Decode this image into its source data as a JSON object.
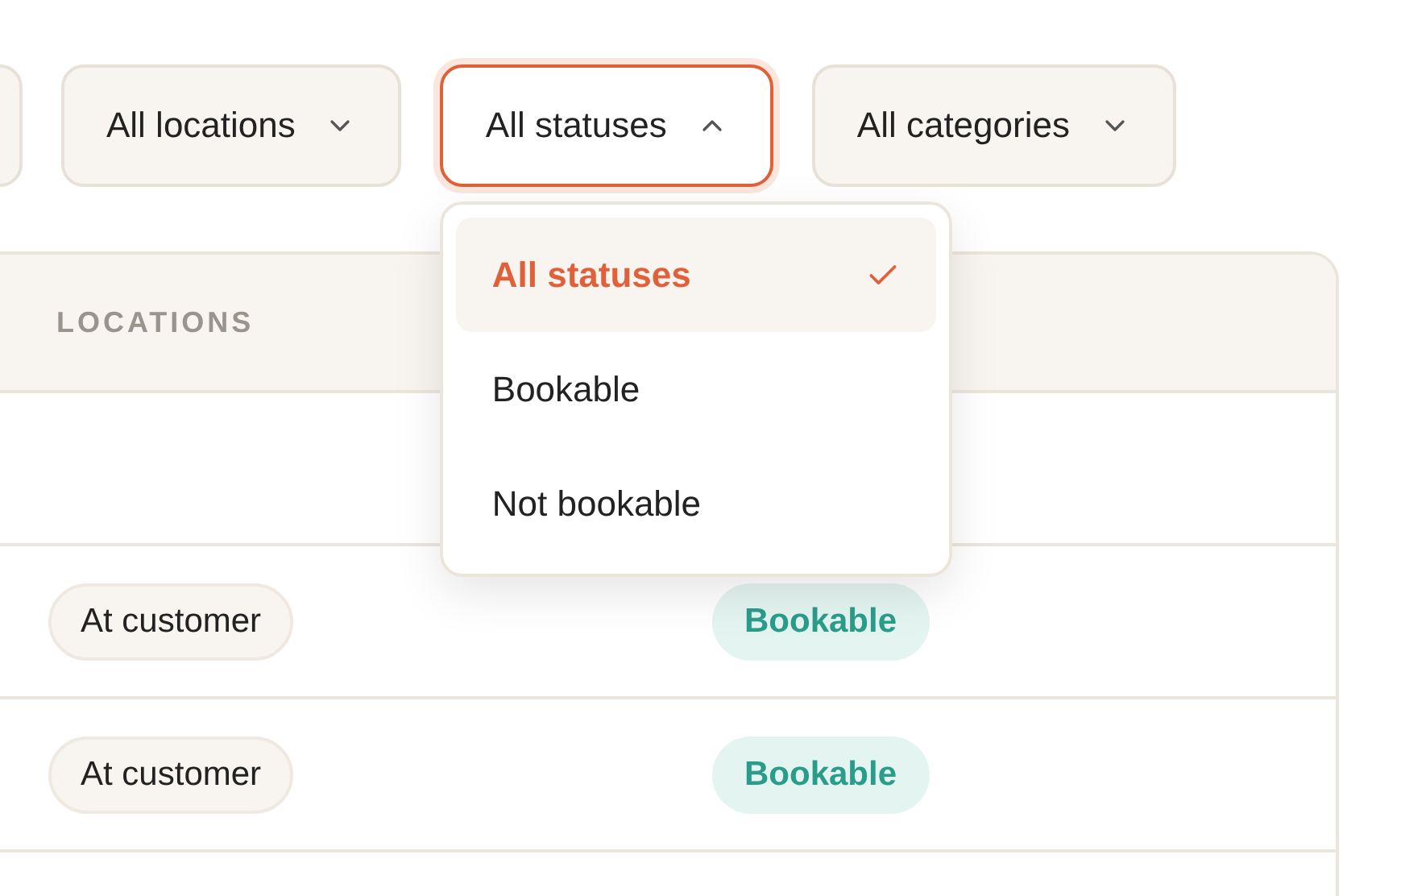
{
  "filters": [
    {
      "label": "All locations",
      "open": false
    },
    {
      "label": "All statuses",
      "open": true,
      "options": [
        {
          "label": "All statuses",
          "selected": true
        },
        {
          "label": "Bookable",
          "selected": false
        },
        {
          "label": "Not bookable",
          "selected": false
        }
      ]
    },
    {
      "label": "All categories",
      "open": false
    }
  ],
  "table": {
    "columns": [
      "LOCATIONS"
    ],
    "rows": [
      {
        "kind": "empty"
      },
      {
        "kind": "item",
        "location": "At customer",
        "status": "Bookable"
      },
      {
        "kind": "item",
        "location": "At customer",
        "status": "Bookable"
      }
    ]
  }
}
